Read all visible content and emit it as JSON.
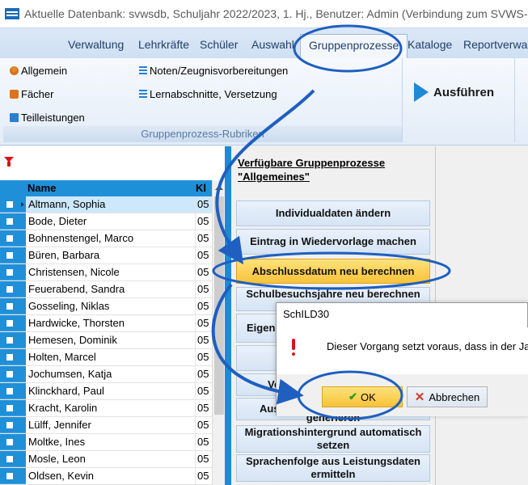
{
  "window": {
    "title": "Aktuelle Datenbank: svwsdb, Schuljahr 2022/2023, 1. Hj., Benutzer: Admin (Verbindung zum SVWS-Server v"
  },
  "ribbon_tabs": [
    {
      "label": "Verwaltung"
    },
    {
      "label": "Lehrkräfte"
    },
    {
      "label": "Schüler"
    },
    {
      "label": "Auswahl"
    },
    {
      "label": "Gruppenprozesse",
      "active": true
    },
    {
      "label": "Kataloge"
    },
    {
      "label": "Reportverwalt"
    }
  ],
  "ribbon": {
    "items_left": [
      {
        "label": "Allgemein",
        "icon": "person-icon"
      },
      {
        "label": "Fächer",
        "icon": "book-icon"
      },
      {
        "label": "Teilleistungen",
        "icon": "doc-icon"
      }
    ],
    "items_right": [
      {
        "label": "Noten/Zeugnisvorbereitungen",
        "icon": "list-icon"
      },
      {
        "label": "Lernabschnitte, Versetzung",
        "icon": "list-icon"
      }
    ],
    "group_label": "Gruppenprozess-Rubriken",
    "run_label": "Ausführen"
  },
  "student_grid": {
    "columns": {
      "name": "Name",
      "klasse": "Kl"
    },
    "rows": [
      {
        "name": "Altmann, Sophia",
        "kl": "05",
        "selected": true
      },
      {
        "name": "Bode, Dieter",
        "kl": "05"
      },
      {
        "name": "Bohnenstengel, Marco",
        "kl": "05"
      },
      {
        "name": "Büren, Barbara",
        "kl": "05"
      },
      {
        "name": "Christensen, Nicole",
        "kl": "05"
      },
      {
        "name": "Feuerabend, Sandra",
        "kl": "05"
      },
      {
        "name": "Gosseling, Niklas",
        "kl": "05"
      },
      {
        "name": "Hardwicke, Thorsten",
        "kl": "05"
      },
      {
        "name": "Hemesen, Dominik",
        "kl": "05"
      },
      {
        "name": "Holten, Marcel",
        "kl": "05"
      },
      {
        "name": "Jochumsen, Katja",
        "kl": "05"
      },
      {
        "name": "Klinckhard, Paul",
        "kl": "05"
      },
      {
        "name": "Kracht, Karolin",
        "kl": "05"
      },
      {
        "name": "Lülff, Jennifer",
        "kl": "05"
      },
      {
        "name": "Moltke, Ines",
        "kl": "05"
      },
      {
        "name": "Mosle, Leon",
        "kl": "05"
      },
      {
        "name": "Oldsen, Kevin",
        "kl": "05"
      }
    ]
  },
  "process_panel": {
    "heading_line1": "Verfügbare Gruppenprozesse",
    "heading_line2": "\"Allgemeines\"",
    "buttons": [
      {
        "label": "Individualdaten ändern"
      },
      {
        "label": "Eintrag in Wiedervorlage machen"
      },
      {
        "label": "Abschlussdatum neu berechnen",
        "highlight": true
      },
      {
        "label": "Schulbesuchsjahre neu berechnen"
      },
      {
        "label": "Eigene"
      },
      {
        "label": ""
      },
      {
        "label": "Ve"
      },
      {
        "label": "Aus"
      },
      {
        "label": "generieren"
      },
      {
        "label": "Migrationshintergrund automatisch setzen"
      },
      {
        "label": "Sprachenfolge aus Leistungsdaten ermitteln"
      }
    ]
  },
  "dialog": {
    "title": "SchILD30",
    "message": "Dieser Vorgang setzt voraus, dass in der Jahrg",
    "ok_label": "OK",
    "cancel_label": "Abbrechen"
  },
  "colors": {
    "accent_blue": "#1e8ad6",
    "highlight_yellow": "#f7c23a",
    "warning_red": "#d8141a"
  }
}
